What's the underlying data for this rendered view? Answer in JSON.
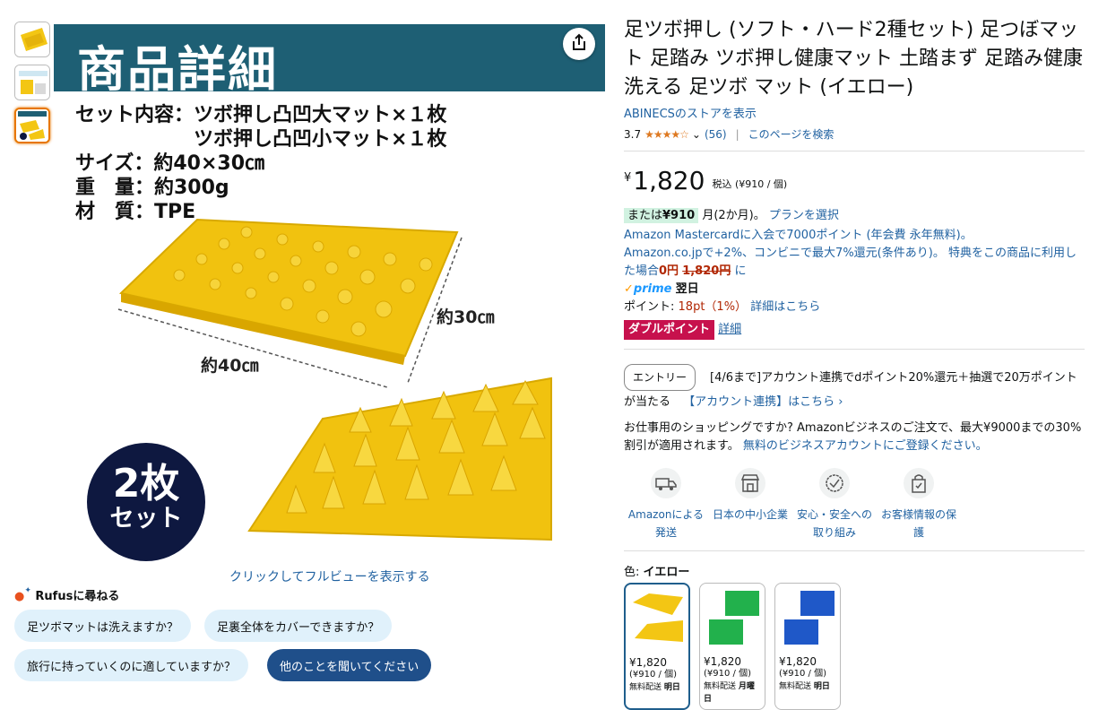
{
  "gallery": {
    "banner_title": "商品詳細",
    "spec_lines": [
      "セット内容：ツボ押し凸凹大マット×１枚",
      "　　　　　　ツボ押し凸凹小マット×１枚",
      "サイズ：約40×30㎝",
      "重　量：約300g",
      "材　質：TPE"
    ],
    "dim_width": "約40㎝",
    "dim_height": "約30㎝",
    "badge_line1": "2枚",
    "badge_line2": "セット",
    "fullview_link": "クリックしてフルビューを表示する"
  },
  "rufus": {
    "title": "Rufusに尋ねる",
    "chips": [
      "足ツボマットは洗えますか？",
      "足裏全体をカバーできますか？",
      "旅行に持っていくのに適していますか？",
      "他のことを聞いてください"
    ]
  },
  "product": {
    "title": "足ツボ押し (ソフト・ハード2種セット) 足つぼマット 足踏み ツボ押し健康マット 土踏まず 足踏み健康 洗える 足ツボ マット (イエロー)",
    "store_link": "ABINECSのストアを表示",
    "rating_value": "3.7",
    "rating_stars": "★★★★☆",
    "rating_count": "(56)",
    "search_page": "このページを検索",
    "price_symbol": "¥",
    "price": "1,820",
    "tax_note": "税込 (¥910 / 個)",
    "installment_prefix": "または",
    "installment_amount": "¥910",
    "installment_suffix": "月(2か月)。",
    "plan_link": "プランを選択",
    "mastercard_line": "Amazon Mastercardに入会で7000ポイント (年会費 永年無料)。",
    "cashback_line": "Amazon.co.jpで+2%、コンビニで最大7%還元(条件あり)。 特典をこの商品に利用した場合",
    "cashback_zero": "0円",
    "cashback_strike": "1,820円",
    "cashback_end": "に",
    "prime_label": "prime",
    "prime_delivery": "翌日",
    "points_label": "ポイント:",
    "points_value": "18pt（1%）",
    "points_link": "詳細はこちら",
    "double_point": "ダブルポイント",
    "double_point_link": "詳細",
    "entry_button": "エントリー",
    "campaign_text": "[4/6まで]アカウント連携でdポイント20%還元＋抽選で20万ポイントが当たる",
    "campaign_link": "【アカウント連携】はこちら ›",
    "business_text": "お仕事用のショッピングですか? Amazonビジネスのご注文で、最大¥9000までの30%割引が適用されます。",
    "business_link": "無料のビジネスアカウントにご登録ください。",
    "features": [
      {
        "label": "Amazonによる発送",
        "icon": "truck-icon"
      },
      {
        "label": "日本の中小企業",
        "icon": "store-icon"
      },
      {
        "label": "安心・安全への取り組み",
        "icon": "badge-check-icon"
      },
      {
        "label": "お客様情報の保護",
        "icon": "lock-bag-icon"
      }
    ],
    "color_label": "色:",
    "color_value": "イエロー",
    "variants": [
      {
        "price": "¥1,820",
        "per": "(¥910 / 個)",
        "ship": "無料配送",
        "ship_day": "明日",
        "color": "#f3c614"
      },
      {
        "price": "¥1,820",
        "per": "(¥910 / 個)",
        "ship": "無料配送",
        "ship_day": "月曜日",
        "color": "#22b14c"
      },
      {
        "price": "¥1,820",
        "per": "(¥910 / 個)",
        "ship": "無料配送",
        "ship_day": "明日",
        "color": "#1f58c8"
      }
    ]
  },
  "colors": {
    "accent_link": "#2162a1",
    "banner": "#1e5f74",
    "price_red": "#b12704",
    "double_point": "#c7114d",
    "mat_yellow": "#f3c614"
  }
}
